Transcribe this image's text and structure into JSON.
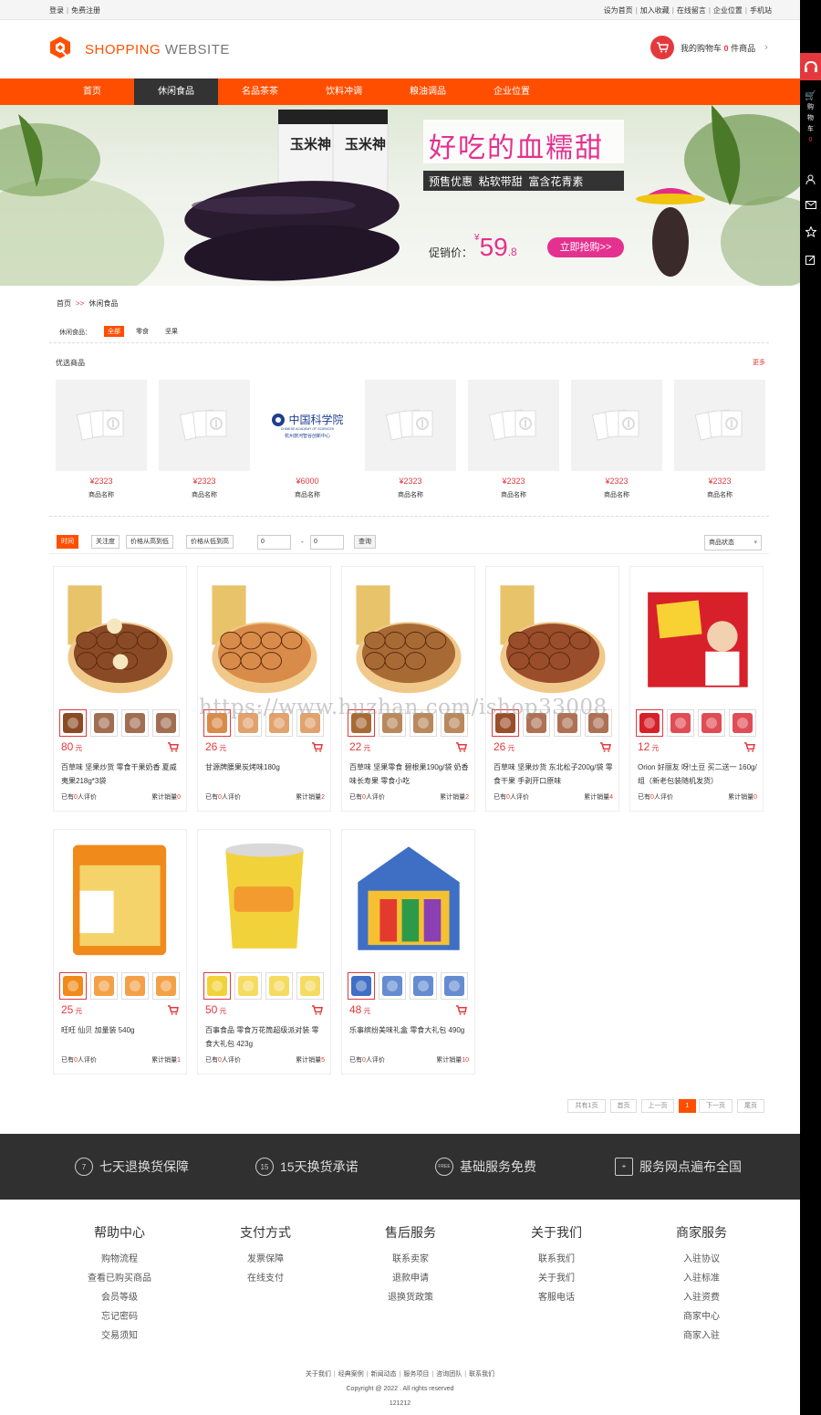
{
  "topbar": {
    "login": "登录",
    "register": "免费注册",
    "links": [
      "设为首页",
      "加入收藏",
      "在线留言",
      "企业位置",
      "手机站"
    ]
  },
  "logo": {
    "a": "SHOPPING",
    "b": "WEBSITE"
  },
  "cart": {
    "prefix": "我的购物车",
    "count": "0",
    "suffix": "件商品"
  },
  "nav": [
    "首页",
    "休闲食品",
    "名品茶茶",
    "饮料冲调",
    "粮油调品",
    "企业位置"
  ],
  "banner": {
    "headline": "好吃的血糯甜",
    "tags": "预售优惠  粘软带甜  富含花青素",
    "sale_label": "促销价：",
    "currency": "¥",
    "price": "59",
    "price_dec": ".8",
    "cta": "立即抢购>>",
    "pack_text": "玉米神"
  },
  "sidebar": {
    "cart_label": [
      "购",
      "物",
      "车"
    ],
    "cart_count": "0"
  },
  "breadcrumb": {
    "home": "首页",
    "arrow": ">>",
    "current": "休闲食品"
  },
  "filter": {
    "label": "休闲食品：",
    "options": [
      "全部",
      "零食",
      "坚果"
    ]
  },
  "recommend": {
    "title": "优选商品",
    "more": "更多",
    "items": [
      {
        "price": "¥2323",
        "name": "商品名称"
      },
      {
        "price": "¥2323",
        "name": "商品名称"
      },
      {
        "price": "¥6000",
        "name": "商品名称",
        "logo_line1": "中国科学院",
        "logo_line2": "CHINESE ACADEMY OF SCIENCES",
        "logo_line3": "杭州旅河智谷创新中心"
      },
      {
        "price": "¥2323",
        "name": "商品名称"
      },
      {
        "price": "¥2323",
        "name": "商品名称"
      },
      {
        "price": "¥2323",
        "name": "商品名称"
      },
      {
        "price": "¥2323",
        "name": "商品名称"
      }
    ]
  },
  "sort": {
    "buttons": [
      "时间",
      "关注度",
      "价格从高到低",
      "价格从低到高"
    ],
    "min": "0",
    "dash": "-",
    "max": "0",
    "query": "查询",
    "status": "商品状态"
  },
  "products": [
    {
      "price": "80",
      "unit": "元",
      "name": "百草味 坚果炒货 零食干果奶香 夏威夷果218g*3袋",
      "reviews_pre": "已有",
      "reviews": "0",
      "reviews_post": "人评价",
      "sales_pre": "累计销量",
      "sales": "0",
      "color": "#8b4a26",
      "label": "macadamia"
    },
    {
      "price": "26",
      "unit": "元",
      "name": "甘源牌腰果炭烤味180g",
      "reviews_pre": "已有",
      "reviews": "0",
      "reviews_post": "人评价",
      "sales_pre": "累计销量",
      "sales": "2",
      "color": "#d98b4a",
      "label": "cashew"
    },
    {
      "price": "22",
      "unit": "元",
      "name": "百草味 坚果零食 碧根果190g/袋 奶香味长寿果 零食小吃",
      "reviews_pre": "已有",
      "reviews": "0",
      "reviews_post": "人评价",
      "sales_pre": "累计销量",
      "sales": "2",
      "color": "#a86a35",
      "label": "pecan"
    },
    {
      "price": "26",
      "unit": "元",
      "name": "百草味 坚果炒货 东北松子200g/袋 零食干果 手剥开口原味",
      "reviews_pre": "已有",
      "reviews": "0",
      "reviews_post": "人评价",
      "sales_pre": "累计销量",
      "sales": "4",
      "color": "#9a4d2a",
      "label": "pine-nut"
    },
    {
      "price": "12",
      "unit": "元",
      "name": "Orion 好丽友 呀!土豆 买二送一 160g/组（新老包装随机发货）",
      "reviews_pre": "已有",
      "reviews": "0",
      "reviews_post": "人评价",
      "sales_pre": "累计销量",
      "sales": "0",
      "color": "#d8202a",
      "label": "potato-snack"
    },
    {
      "price": "25",
      "unit": "元",
      "name": "旺旺 仙贝 加量装 540g",
      "reviews_pre": "已有",
      "reviews": "0",
      "reviews_post": "人评价",
      "sales_pre": "累计销量",
      "sales": "1",
      "color": "#f08a1a",
      "label": "rice-cracker"
    },
    {
      "price": "50",
      "unit": "元",
      "name": "百事食品 零食万花筒超级派对装 零食大礼包 423g",
      "reviews_pre": "已有",
      "reviews": "0",
      "reviews_post": "人评价",
      "sales_pre": "累计销量",
      "sales": "5",
      "color": "#f2d23a",
      "label": "party-pack"
    },
    {
      "price": "48",
      "unit": "元",
      "name": "乐事缤纷美味礼盒 零食大礼包 490g",
      "reviews_pre": "已有",
      "reviews": "0",
      "reviews_post": "人评价",
      "sales_pre": "累计销量",
      "sales": "10",
      "color": "#3f6fc4",
      "label": "gift-box"
    }
  ],
  "pagination": [
    "共有1页",
    "首页",
    "上一页",
    "1",
    "下一页",
    "尾页"
  ],
  "services": [
    {
      "icon": "7",
      "text": "七天退换货保障"
    },
    {
      "icon": "15",
      "text": "15天换货承诺"
    },
    {
      "icon": "FREE",
      "text": "基础服务免费"
    },
    {
      "icon": "map",
      "text": "服务网点遍布全国"
    }
  ],
  "footer_cols": [
    {
      "h": "帮助中心",
      "links": [
        "购物流程",
        "查看已购买商品",
        "会员等级",
        "忘记密码",
        "交易须知"
      ]
    },
    {
      "h": "支付方式",
      "links": [
        "发票保障",
        "在线支付"
      ]
    },
    {
      "h": "售后服务",
      "links": [
        "联系卖家",
        "退款申请",
        "退换货政策"
      ]
    },
    {
      "h": "关于我们",
      "links": [
        "联系我们",
        "关于我们",
        "客服电话"
      ]
    },
    {
      "h": "商家服务",
      "links": [
        "入驻协议",
        "入驻标准",
        "入驻资费",
        "商家中心",
        "商家入驻"
      ]
    }
  ],
  "footer": {
    "links": [
      "关于我们",
      "经典案例",
      "新闻动态",
      "服务项目",
      "咨询团队",
      "联系我们"
    ],
    "copyright": "Copyright @ 2022 . All rights reserved",
    "icp": "121212"
  },
  "watermark": "https://www.huzhan.com/ishop33008",
  "colors": {
    "accent": "#ff4e00",
    "price": "#e4393c",
    "dark": "#303030"
  }
}
